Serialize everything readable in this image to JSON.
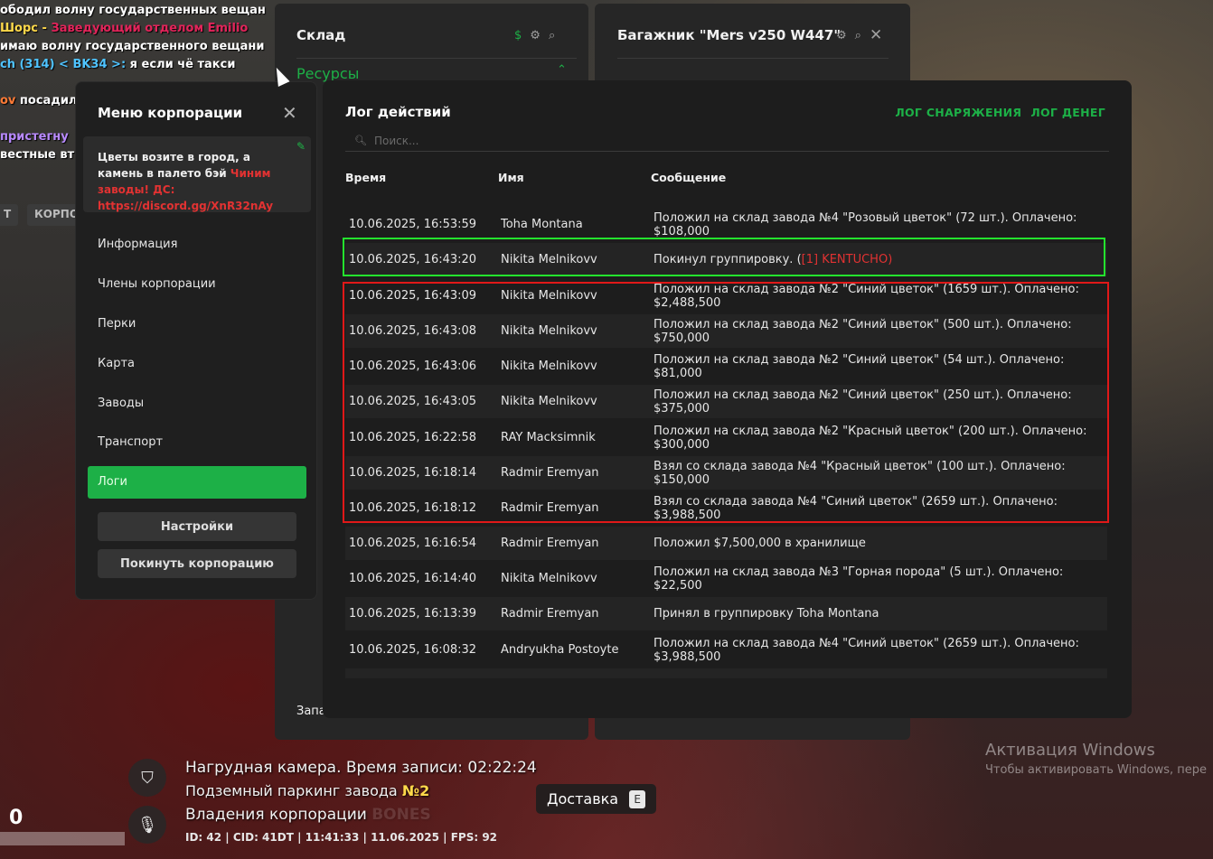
{
  "chat": {
    "l1": {
      "text": "ободил волну государственных вещан"
    },
    "l2": {
      "a": "Шорс - ",
      "b": "Заведующий отделом Emilio"
    },
    "l3": {
      "text": "имаю волну государственного вещани"
    },
    "l4": {
      "a": "ch (314) < BK34 >: ",
      "b": "я если чё такси"
    },
    "l5": {
      "a": "ov",
      "b": " посадил"
    },
    "l6": {
      "text": "пристегну"
    },
    "l7": {
      "text": "вестные вт"
    },
    "chip1": "Т",
    "chip2": "КОРПО"
  },
  "warehouse": {
    "title": "Склад",
    "section": "Ресурсы",
    "footer": "Запа"
  },
  "trunk": {
    "title": "Багажник \"Mers v250 W447\""
  },
  "corp_menu": {
    "title": "Меню корпорации",
    "motd": {
      "text": "Цветы возите в город, а камень в палето бэй ",
      "red": "Чиним заводы! ДС: https://discord.gg/XnR32nAy"
    },
    "nav": [
      "Информация",
      "Члены корпорации",
      "Перки",
      "Карта",
      "Заводы",
      "Транспорт",
      "Логи"
    ],
    "active_index": 6,
    "settings_button": "Настройки",
    "leave_button": "Покинуть корпорацию"
  },
  "log": {
    "title": "Лог действий",
    "link_equipment": "ЛОГ СНАРЯЖЕНИЯ",
    "link_money": "ЛОГ ДЕНЕГ",
    "search_placeholder": "Поиск...",
    "headers": {
      "time": "Время",
      "name": "Имя",
      "message": "Сообщение"
    },
    "rows": [
      {
        "time": "10.06.2025, 16:53:59",
        "name": "Toha Montana",
        "message": "Положил на склад завода №4 \"Розовый цветок\" (72 шт.). Оплачено: $108,000"
      },
      {
        "time": "10.06.2025, 16:43:20",
        "name": "Nikita Melnikovv",
        "message": "Покинул группировку. (",
        "red": "[1] KENTUCHO)"
      },
      {
        "time": "10.06.2025, 16:43:09",
        "name": "Nikita Melnikovv",
        "message": "Положил на склад завода №2 \"Синий цветок\" (1659 шт.). Оплачено: $2,488,500"
      },
      {
        "time": "10.06.2025, 16:43:08",
        "name": "Nikita Melnikovv",
        "message": "Положил на склад завода №2 \"Синий цветок\" (500 шт.). Оплачено: $750,000"
      },
      {
        "time": "10.06.2025, 16:43:06",
        "name": "Nikita Melnikovv",
        "message": "Положил на склад завода №2 \"Синий цветок\" (54 шт.). Оплачено: $81,000"
      },
      {
        "time": "10.06.2025, 16:43:05",
        "name": "Nikita Melnikovv",
        "message": "Положил на склад завода №2 \"Синий цветок\" (250 шт.). Оплачено: $375,000"
      },
      {
        "time": "10.06.2025, 16:22:58",
        "name": "RAY Macksimnik",
        "message": "Положил на склад завода №2 \"Красный цветок\" (200 шт.). Оплачено: $300,000"
      },
      {
        "time": "10.06.2025, 16:18:14",
        "name": "Radmir Eremyan",
        "message": "Взял со склада завода №4 \"Красный цветок\" (100 шт.). Оплачено: $150,000"
      },
      {
        "time": "10.06.2025, 16:18:12",
        "name": "Radmir Eremyan",
        "message": "Взял со склада завода №4 \"Синий цветок\" (2659 шт.). Оплачено: $3,988,500"
      },
      {
        "time": "10.06.2025, 16:16:54",
        "name": "Radmir Eremyan",
        "message": "Положил $7,500,000 в хранилище"
      },
      {
        "time": "10.06.2025, 16:14:40",
        "name": "Nikita Melnikovv",
        "message": "Положил на склад завода №3 \"Горная порода\" (5 шт.). Оплачено: $22,500"
      },
      {
        "time": "10.06.2025, 16:13:39",
        "name": "Radmir Eremyan",
        "message": "Принял в группировку Toha Montana"
      },
      {
        "time": "10.06.2025, 16:08:32",
        "name": "Andryukha Postoyte",
        "message": "Положил на склад завода №4 \"Синий цветок\" (2659 шт.). Оплачено: $3,988,500"
      }
    ]
  },
  "hud": {
    "bodycam": "Нагрудная камера. Время записи: 02:22:24",
    "location_text": "Подземный паркинг завода ",
    "location_num": "№2",
    "ownership_text": "Владения корпорации ",
    "ownership_name": "BONES",
    "info": "ID: 42 | CID: 41DT | 11:41:33    | 11.06.2025 | FPS: 92",
    "delivery": "Доставка",
    "delivery_key": "E",
    "counter": "0"
  },
  "windows_activation": {
    "title": "Активация Windows",
    "subtitle": "Чтобы активировать Windows, пере"
  },
  "colors": {
    "accent_green": "#1db047",
    "highlight_green": "#24e22e",
    "highlight_red": "#e01818",
    "link_red": "#e23232"
  }
}
